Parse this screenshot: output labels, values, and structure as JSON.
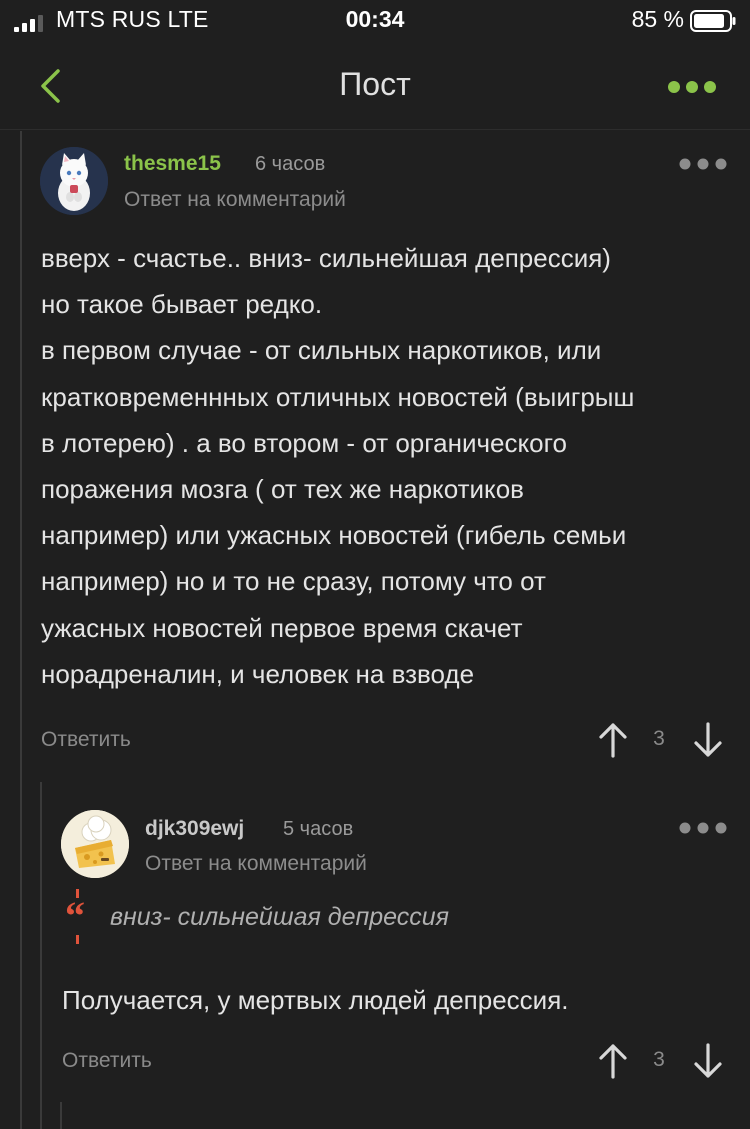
{
  "status_bar": {
    "carrier": "MTS RUS  LTE",
    "time": "00:34",
    "battery": "85 %"
  },
  "nav": {
    "title": "Пост"
  },
  "colors": {
    "accent": "#8bc34a",
    "background": "#1f1f1f",
    "quote_red": "#e0533b"
  },
  "comments": [
    {
      "author": "thesme15",
      "time": "6 часов",
      "reply_to": "Ответ на комментарий",
      "lines": [
        "вверх - счастье.. вниз- сильнейшая депрессия)",
        "но такое бывает редко.",
        "в первом случае - от сильных наркотиков, или",
        "кратковременнных отличных новостей (выигрыш",
        "в лотерею) . а во втором - от органического",
        "поражения мозга ( от тех же наркотиков",
        "например) или ужасных новостей (гибель семьи",
        "например) но и то не сразу, потому что от",
        "ужасных новостей первое время скачет",
        "норадреналин, и человек на взводе"
      ],
      "reply_label": "Ответить",
      "rating": "3"
    },
    {
      "author": "djk309ewj",
      "time": "5 часов",
      "reply_to": "Ответ на комментарий",
      "quote": "вниз- сильнейшая депрессия",
      "text": "Получается, у мертвых людей депрессия.",
      "reply_label": "Ответить",
      "rating": "3"
    }
  ]
}
